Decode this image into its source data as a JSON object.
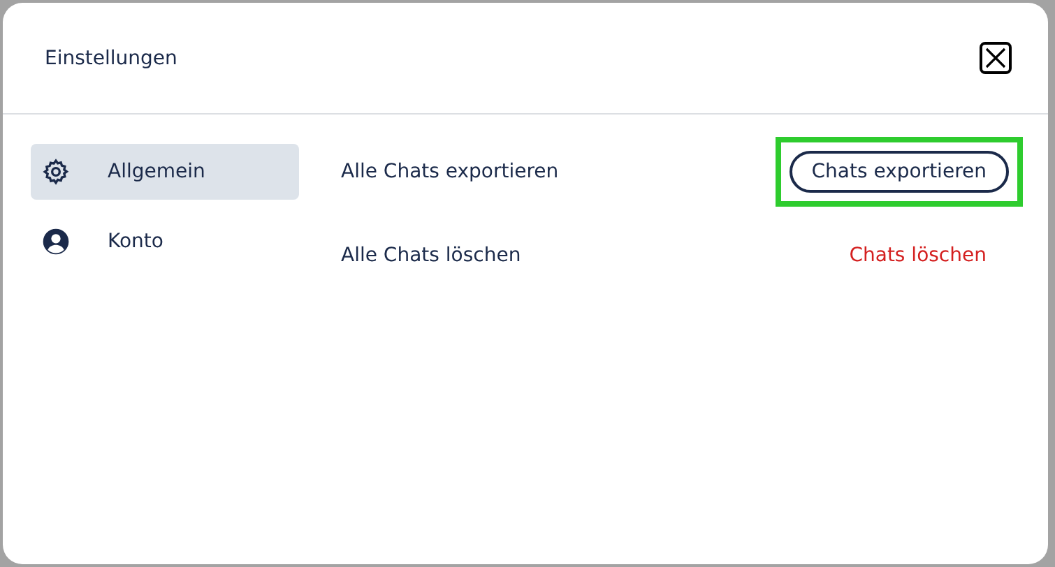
{
  "dialog": {
    "title": "Einstellungen"
  },
  "sidebar": {
    "items": [
      {
        "label": "Allgemein",
        "selected": true
      },
      {
        "label": "Konto",
        "selected": false
      }
    ]
  },
  "settings": [
    {
      "label": "Alle Chats exportieren",
      "action": "Chats exportieren",
      "kind": "outline",
      "highlighted": true
    },
    {
      "label": "Alle Chats löschen",
      "action": "Chats löschen",
      "kind": "danger",
      "highlighted": false
    }
  ]
}
